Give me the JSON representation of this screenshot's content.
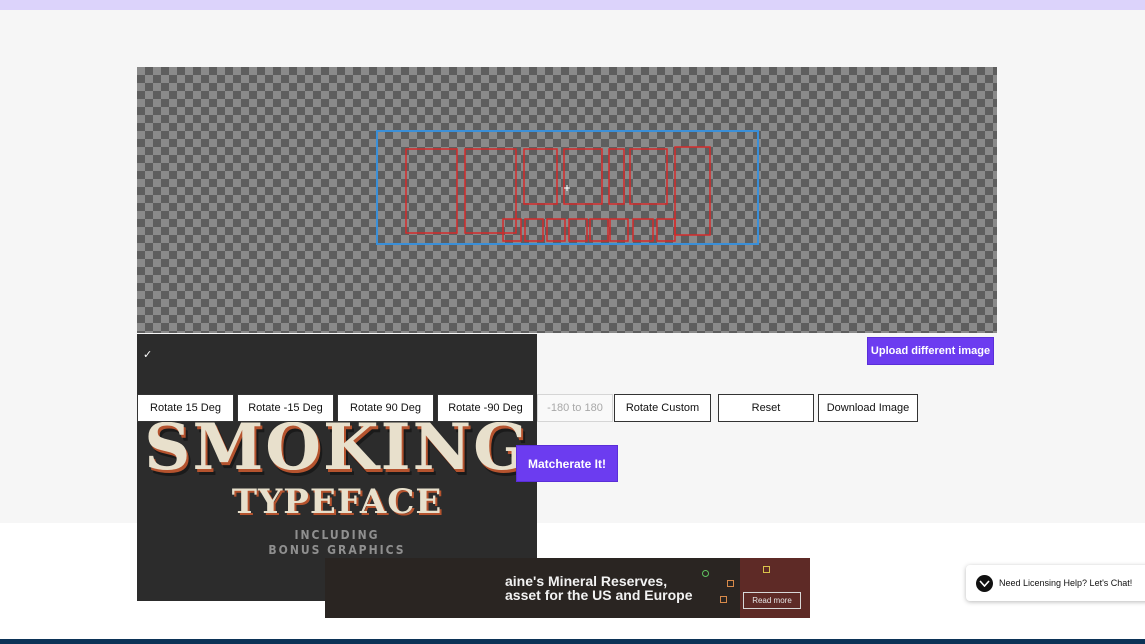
{
  "colors": {
    "accent": "#6c3cf0",
    "top_bar": "#dcd3fb",
    "work_area_bg": "#f6f6f6",
    "canvas_dark": "#5e5e5e",
    "canvas_light": "#8a8a8a",
    "selection_box": "#3a8fd8",
    "detection_box": "#d42a2a",
    "footer_bar": "#0c3357"
  },
  "toolbar": {
    "rotate_15": "Rotate 15 Deg",
    "rotate_minus_15": "Rotate -15 Deg",
    "rotate_90": "Rotate 90 Deg",
    "rotate_minus_90": "Rotate -90 Deg",
    "degree_placeholder": "-180 to 180",
    "rotate_custom": "Rotate Custom",
    "reset": "Reset",
    "download": "Download Image"
  },
  "actions": {
    "upload": "Upload different image",
    "matcherate": "Matcherate It!"
  },
  "ad": {
    "check_icon": "checkmark-icon",
    "check_glyph": "✓",
    "title_line1": "SMOKING",
    "title_line2": "TYPEFACE",
    "sub_line1": "INCLUDING",
    "sub_line2": "BONUS GRAPHICS"
  },
  "banner": {
    "line1": "aine's Mineral Reserves,",
    "line2": "asset for the US and Europe",
    "read_more": "Read more"
  },
  "chat": {
    "icon": "chat-bubble-icon",
    "label": "Need Licensing Help? Let's Chat!"
  }
}
